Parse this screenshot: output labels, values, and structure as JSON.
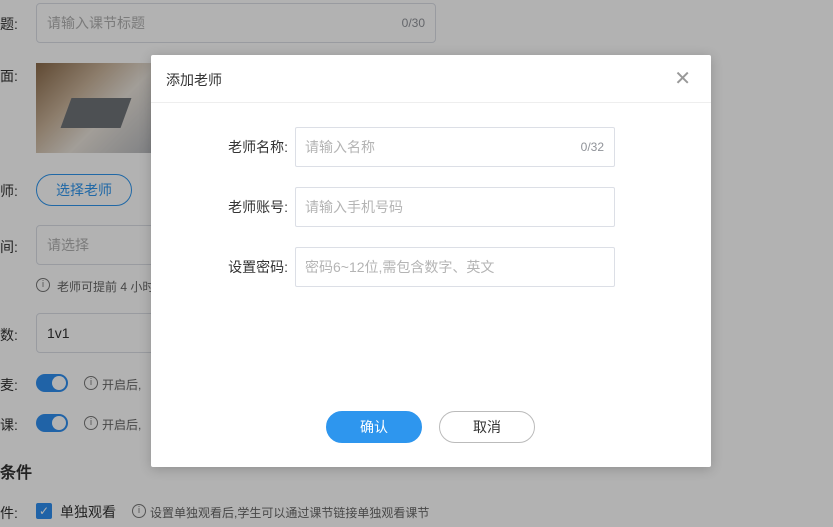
{
  "background": {
    "title_label": "题:",
    "title_input_placeholder": "请输入课节标题",
    "title_counter": "0/30",
    "cover_label": "面:",
    "teacher_label": "师:",
    "select_teacher_button": "选择老师",
    "time_label": "间:",
    "time_placeholder": "请选择",
    "time_hint": "老师可提前 4 小时",
    "count_label": "数:",
    "count_value": "1v1",
    "mic_label": "麦:",
    "mic_hint": "开启后,",
    "class_label": "课:",
    "class_hint": "开启后,",
    "section_heading": "条件",
    "watch_label": "件:",
    "watch_checkbox_label": "单独观看",
    "watch_hint": "设置单独观看后,学生可以通过课节链接单独观看课节",
    "info_glyph": "i"
  },
  "modal": {
    "title": "添加老师",
    "close_glyph": "✕",
    "fields": [
      {
        "label": "老师名称:",
        "placeholder": "请输入名称",
        "counter": "0/32"
      },
      {
        "label": "老师账号:",
        "placeholder": "请输入手机号码"
      },
      {
        "label": "设置密码:",
        "placeholder": "密码6~12位,需包含数字、英文"
      }
    ],
    "confirm_label": "确认",
    "cancel_label": "取消"
  },
  "colors": {
    "accent": "#2e96ee",
    "overlay": "rgba(0,0,0,0.3)"
  }
}
